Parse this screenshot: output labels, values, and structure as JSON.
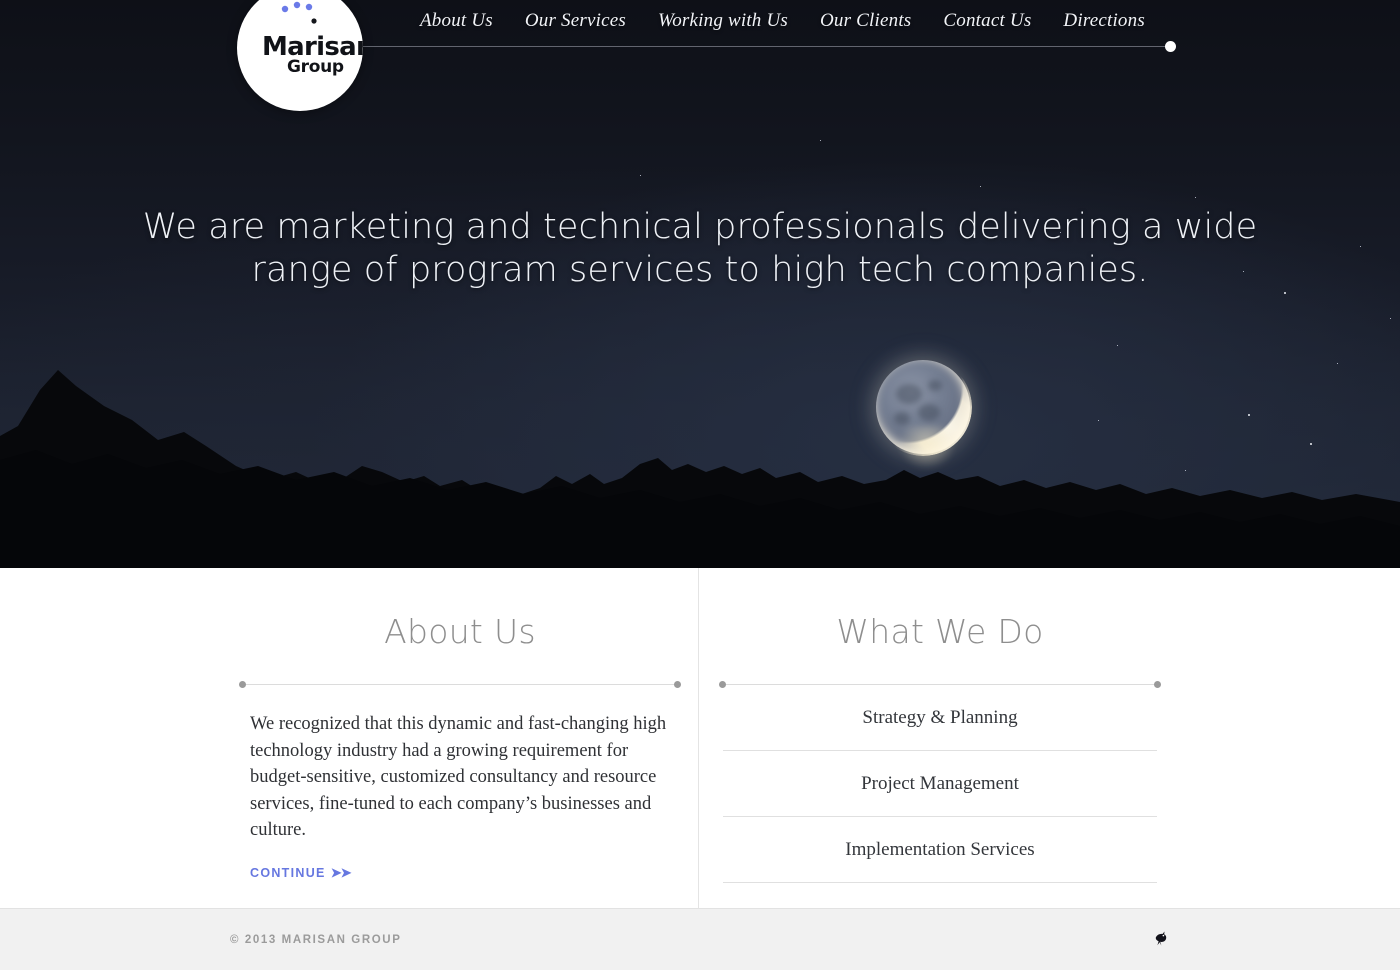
{
  "brand": {
    "logo_name": "Marisan",
    "logo_sub": "Group"
  },
  "nav": {
    "items": [
      {
        "label": "About Us"
      },
      {
        "label": "Our Services"
      },
      {
        "label": "Working with Us"
      },
      {
        "label": "Our Clients"
      },
      {
        "label": "Contact Us"
      },
      {
        "label": "Directions"
      }
    ]
  },
  "hero": {
    "headline": "We are marketing and technical professionals delivering a wide range of program services to high tech companies."
  },
  "about": {
    "title": "About Us",
    "body": "We recognized that this dynamic and fast-changing high technology industry had a growing requirement for budget-sensitive, customized consultancy and resource services, fine-tuned to each company’s businesses and culture.",
    "continue_label": "CONTINUE",
    "continue_arrow": "➤➤"
  },
  "what_we_do": {
    "title": "What We Do",
    "items": [
      {
        "label": "Strategy & Planning"
      },
      {
        "label": "Project Management"
      },
      {
        "label": "Implementation Services"
      }
    ]
  },
  "footer": {
    "copyright": "© 2013 MARISAN GROUP"
  },
  "colors": {
    "accent": "#6677e0",
    "hero_sky_top": "#0e1017",
    "hero_sky_bottom": "#222a3a",
    "heading_gray": "#8e8e8e",
    "footer_bg": "#f1f1f1"
  }
}
